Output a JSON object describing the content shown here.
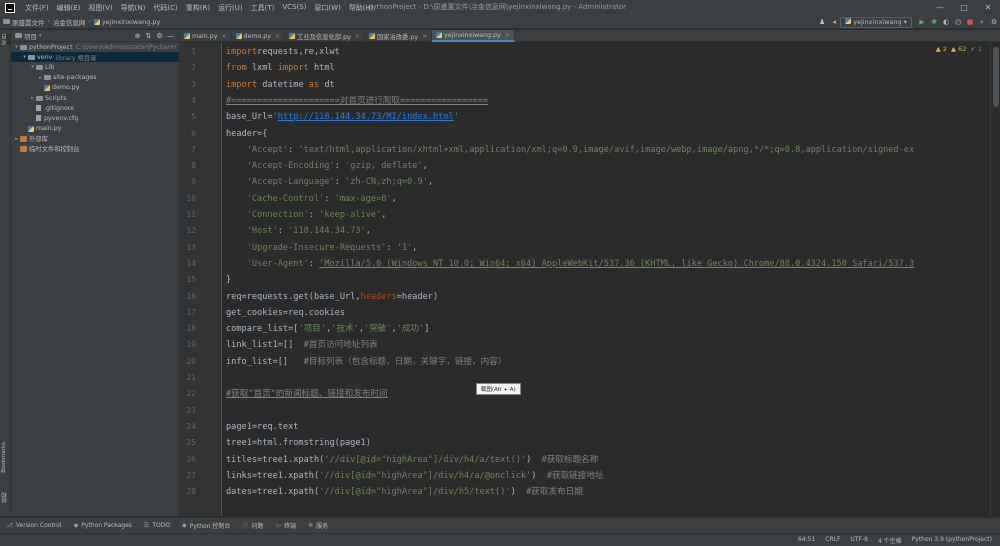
{
  "window": {
    "title": "pythonProject - D:\\原盛置文件\\冶金信息网\\yejinxinxiwang.py - Administrator",
    "minimize": "—",
    "maximize": "□",
    "close": "✕"
  },
  "menu": [
    "文件(F)",
    "编辑(E)",
    "视图(V)",
    "导航(N)",
    "代码(C)",
    "重构(R)",
    "运行(U)",
    "工具(T)",
    "VCS(S)",
    "窗口(W)",
    "帮助(H)"
  ],
  "breadcrumb": [
    "原盛置文件",
    "冶金信息网",
    "yejinxinxiwang.py"
  ],
  "run_config": "yejinxinxiwang",
  "project_panel": {
    "title": "项目",
    "tree": [
      {
        "label": "pythonProject",
        "hint": "C:\\Users\\Administrator\\Pycharm",
        "indent": 0,
        "arrow": "▾",
        "icon": "folder",
        "selected": false
      },
      {
        "label": "venv",
        "hint": "library 根目录",
        "indent": 1,
        "arrow": "▾",
        "icon": "folder",
        "selected": true
      },
      {
        "label": "Lib",
        "hint": "",
        "indent": 2,
        "arrow": "▾",
        "icon": "folder",
        "selected": false
      },
      {
        "label": "site-packages",
        "hint": "",
        "indent": 3,
        "arrow": "▸",
        "icon": "folder",
        "selected": false
      },
      {
        "label": "demo.py",
        "hint": "",
        "indent": 3,
        "arrow": "",
        "icon": "py",
        "selected": false
      },
      {
        "label": "Scripts",
        "hint": "",
        "indent": 2,
        "arrow": "▸",
        "icon": "folder",
        "selected": false
      },
      {
        "label": ".gitignore",
        "hint": "",
        "indent": 2,
        "arrow": "",
        "icon": "file",
        "selected": false
      },
      {
        "label": "pyvenv.cfg",
        "hint": "",
        "indent": 2,
        "arrow": "",
        "icon": "file",
        "selected": false
      },
      {
        "label": "main.py",
        "hint": "",
        "indent": 1,
        "arrow": "",
        "icon": "py",
        "selected": false
      },
      {
        "label": "外部库",
        "hint": "",
        "indent": 0,
        "arrow": "▸",
        "icon": "lib",
        "selected": false
      },
      {
        "label": "临时文件和控制台",
        "hint": "",
        "indent": 0,
        "arrow": "",
        "icon": "lib",
        "selected": false
      }
    ]
  },
  "left_strip": {
    "project": "项目",
    "structure": "结构",
    "bookmarks": "Bookmarks"
  },
  "tabs": [
    {
      "label": "main.py",
      "active": false
    },
    {
      "label": "demo.py",
      "active": false
    },
    {
      "label": "工业及信息化部.py",
      "active": false
    },
    {
      "label": "国家冶改委.py",
      "active": false
    },
    {
      "label": "yejinxinxiwang.py",
      "active": true
    }
  ],
  "inspection": {
    "warnings": "▲ 2",
    "weak": "▲ 62",
    "ok": "✔ 2"
  },
  "code_lines": [
    {
      "n": "1",
      "segs": [
        [
          "kw",
          "import"
        ],
        [
          "",
          "requests,re,xlwt"
        ]
      ]
    },
    {
      "n": "2",
      "segs": [
        [
          "kw",
          "from"
        ],
        [
          "",
          " lxml "
        ],
        [
          "kw",
          "import"
        ],
        [
          "",
          " html"
        ]
      ]
    },
    {
      "n": "3",
      "segs": [
        [
          "kw",
          "import"
        ],
        [
          "",
          " datetime "
        ],
        [
          "kw",
          "as"
        ],
        [
          "",
          " dt"
        ]
      ]
    },
    {
      "n": "4",
      "segs": [
        [
          "cmt under",
          "#=====================对首页进行爬取================="
        ]
      ]
    },
    {
      "n": "5",
      "segs": [
        [
          "",
          "base_Url="
        ],
        [
          "str",
          "'"
        ],
        [
          "url",
          "http://118.144.34.73/MI/index.html"
        ],
        [
          "str",
          "'"
        ]
      ]
    },
    {
      "n": "6",
      "segs": [
        [
          "",
          "header={"
        ]
      ]
    },
    {
      "n": "7",
      "segs": [
        [
          "",
          "    "
        ],
        [
          "str",
          "'Accept'"
        ],
        [
          "",
          ": "
        ],
        [
          "str",
          "'text/html,application/xhtml+xml,application/xml;q=0.9,image/avif,image/webp,image/apng,*/*;q=0.8,application/signed-ex"
        ]
      ]
    },
    {
      "n": "8",
      "segs": [
        [
          "",
          "    "
        ],
        [
          "str",
          "'Accept-Encoding'"
        ],
        [
          "",
          ": "
        ],
        [
          "str",
          "'gzip, deflate'"
        ],
        [
          "",
          ","
        ]
      ]
    },
    {
      "n": "9",
      "segs": [
        [
          "",
          "    "
        ],
        [
          "str",
          "'Accept-Language'"
        ],
        [
          "",
          ": "
        ],
        [
          "str",
          "'zh-CN,zh;q=0.9'"
        ],
        [
          "",
          ","
        ]
      ]
    },
    {
      "n": "10",
      "segs": [
        [
          "",
          "    "
        ],
        [
          "str",
          "'Cache-Control'"
        ],
        [
          "",
          ": "
        ],
        [
          "str",
          "'max-age=0'"
        ],
        [
          "",
          ","
        ]
      ]
    },
    {
      "n": "11",
      "segs": [
        [
          "",
          "    "
        ],
        [
          "str",
          "'Connection'"
        ],
        [
          "",
          ": "
        ],
        [
          "str",
          "'keep-alive'"
        ],
        [
          "",
          ","
        ]
      ]
    },
    {
      "n": "12",
      "segs": [
        [
          "",
          "    "
        ],
        [
          "str",
          "'Host'"
        ],
        [
          "",
          ": "
        ],
        [
          "str",
          "'118.144.34.73'"
        ],
        [
          "",
          ","
        ]
      ]
    },
    {
      "n": "13",
      "segs": [
        [
          "",
          "    "
        ],
        [
          "str",
          "'Upgrade-Insecure-Requests'"
        ],
        [
          "",
          ": "
        ],
        [
          "str",
          "'1'"
        ],
        [
          "",
          ","
        ]
      ]
    },
    {
      "n": "14",
      "segs": [
        [
          "",
          "    "
        ],
        [
          "str",
          "'User-Agent'"
        ],
        [
          "",
          ": "
        ],
        [
          "str under",
          "'Mozilla/5.0 (Windows NT 10.0; Win64; x64) AppleWebKit/537.36 (KHTML, like Gecko) Chrome/88.0.4324.150 Safari/537.3"
        ]
      ]
    },
    {
      "n": "15",
      "segs": [
        [
          "",
          "}"
        ]
      ]
    },
    {
      "n": "16",
      "segs": [
        [
          "",
          "req=requests.get(base_Url,"
        ],
        [
          "kwarg",
          "headers"
        ],
        [
          "",
          "=header)"
        ]
      ]
    },
    {
      "n": "17",
      "segs": [
        [
          "",
          "get_cookies=req.cookies"
        ]
      ]
    },
    {
      "n": "18",
      "segs": [
        [
          "",
          "compare_list=["
        ],
        [
          "str",
          "'项目'"
        ],
        [
          "",
          ","
        ],
        [
          "str",
          "'技术'"
        ],
        [
          "",
          ","
        ],
        [
          "str",
          "'突破'"
        ],
        [
          "",
          ","
        ],
        [
          "str",
          "'成功'"
        ],
        [
          "",
          "]"
        ]
      ]
    },
    {
      "n": "19",
      "segs": [
        [
          "",
          "link_list1=[]  "
        ],
        [
          "cmt",
          "#首页访问地址列表"
        ]
      ]
    },
    {
      "n": "20",
      "segs": [
        [
          "",
          "info_list=[]   "
        ],
        [
          "cmt",
          "#目标列表（包含标题，日期，关键字，链接，内容）"
        ]
      ]
    },
    {
      "n": "21",
      "segs": [
        [
          "",
          ""
        ]
      ]
    },
    {
      "n": "22",
      "segs": [
        [
          "cmt under",
          "#获取\"首页\"的新闻标题、链接和发布时间"
        ]
      ]
    },
    {
      "n": "23",
      "segs": [
        [
          "",
          ""
        ]
      ]
    },
    {
      "n": "24",
      "segs": [
        [
          "",
          "page1=req.text"
        ]
      ]
    },
    {
      "n": "25",
      "segs": [
        [
          "",
          "tree1=html.fromstring(page1)"
        ]
      ]
    },
    {
      "n": "26",
      "segs": [
        [
          "",
          "titles=tree1.xpath("
        ],
        [
          "str",
          "'//div[@id=\"highArea\"]/div/h4/a/text()'"
        ],
        [
          "",
          ")  "
        ],
        [
          "cmt",
          "#获取标题名称"
        ]
      ]
    },
    {
      "n": "27",
      "segs": [
        [
          "",
          "links=tree1.xpath("
        ],
        [
          "str",
          "'//div[@id=\"highArea\"]/div/h4/a/@onclick'"
        ],
        [
          "",
          ")  "
        ],
        [
          "cmt",
          "#获取链接地址"
        ]
      ]
    },
    {
      "n": "28",
      "segs": [
        [
          "",
          "dates=tree1.xpath("
        ],
        [
          "str",
          "'//div[@id=\"highArea\"]/div/h5/text()'"
        ],
        [
          "",
          ")  "
        ],
        [
          "cmt",
          "#获取发布日期"
        ]
      ]
    }
  ],
  "tooltip": "截图(Alt + A)",
  "bottom_tools": [
    {
      "icon": "⎇",
      "label": "Version Control"
    },
    {
      "icon": "◆",
      "label": "Python Packages"
    },
    {
      "icon": "☰",
      "label": "TODO"
    },
    {
      "icon": "◆",
      "label": "Python 控制台"
    },
    {
      "icon": "ⓘ",
      "label": "问题"
    },
    {
      "icon": "▭",
      "label": "终端"
    },
    {
      "icon": "✲",
      "label": "服务"
    }
  ],
  "status": {
    "position": "64:51",
    "line_ending": "CRLF",
    "encoding": "UTF-8",
    "indent": "4 个空格",
    "interpreter": "Python 3.9 (pythonProject)"
  }
}
